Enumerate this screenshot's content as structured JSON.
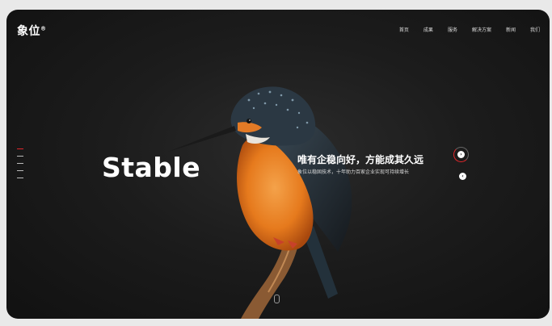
{
  "brand": {
    "logo_text": "象位",
    "logo_mark": "®"
  },
  "nav": {
    "items": [
      "首页",
      "成果",
      "服务",
      "解决方案",
      "新闻",
      "我们"
    ]
  },
  "hero": {
    "word": "Stable",
    "headline": "唯有企稳向好，方能成其久远",
    "subline": "象位以稳固技术，十年助力百家企业实现可持续增长"
  },
  "side_indicator": {
    "count": 5,
    "active_index": 0
  },
  "colors": {
    "accent": "#e1262b",
    "background": "#1a1a1a",
    "bird_orange": "#e9781c",
    "bird_blue": "#3a5a7a"
  },
  "icons": {
    "next": "chevron-right-icon",
    "prev": "chevron-left-icon",
    "scroll": "mouse-scroll-icon"
  }
}
